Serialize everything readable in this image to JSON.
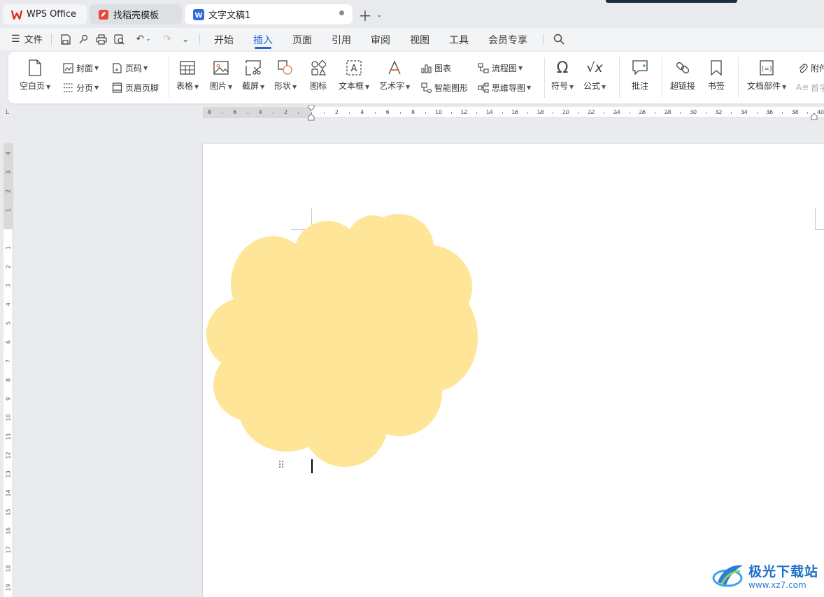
{
  "tabs": [
    {
      "label": "WPS Office",
      "icon": "wps-logo-icon",
      "color": "#e3291f"
    },
    {
      "label": "找稻壳模板",
      "icon": "daoke-logo-icon",
      "color": "#e8483a"
    },
    {
      "label": "文字文稿1",
      "icon": "writer-logo-icon",
      "color": "#2f6de1"
    }
  ],
  "menu": {
    "file_label": "文件",
    "tabs": [
      "开始",
      "插入",
      "页面",
      "引用",
      "审阅",
      "视图",
      "工具",
      "会员专享"
    ],
    "active_tab": "插入"
  },
  "ribbon": {
    "blank_page": "空白页",
    "cover": "封面",
    "page_number": "页码",
    "page_break": "分页",
    "header_footer": "页眉页脚",
    "table": "表格",
    "picture": "图片",
    "screenshot": "截屏",
    "shape": "形状",
    "icons": "图标",
    "textbox": "文本框",
    "wordart": "艺术字",
    "chart": "图表",
    "smartart": "智能图形",
    "flowchart": "流程图",
    "mindmap": "思维导图",
    "symbol": "符号",
    "formula": "公式",
    "comment": "批注",
    "hyperlink": "超链接",
    "bookmark": "书签",
    "doc_parts": "文档部件",
    "attachment": "附件",
    "dropcap": "首字"
  },
  "ruler": {
    "corner": "L",
    "h_ticks": [
      "8",
      "6",
      "4",
      "2",
      "2",
      "4",
      "6",
      "8",
      "10",
      "12",
      "14",
      "16",
      "18",
      "20",
      "22",
      "24",
      "26",
      "28",
      "30",
      "32",
      "34",
      "36",
      "38",
      "40"
    ],
    "v_ticks": [
      "4",
      "3",
      "2",
      "1",
      "1",
      "2",
      "3",
      "4",
      "5",
      "6",
      "7",
      "8",
      "9",
      "10",
      "11",
      "12",
      "13",
      "14",
      "15",
      "16",
      "17",
      "18",
      "19"
    ]
  },
  "document": {
    "shape": "cloud",
    "shape_fill": "#fee597"
  },
  "watermark": {
    "title": "极光下载站",
    "url": "www.xz7.com"
  }
}
